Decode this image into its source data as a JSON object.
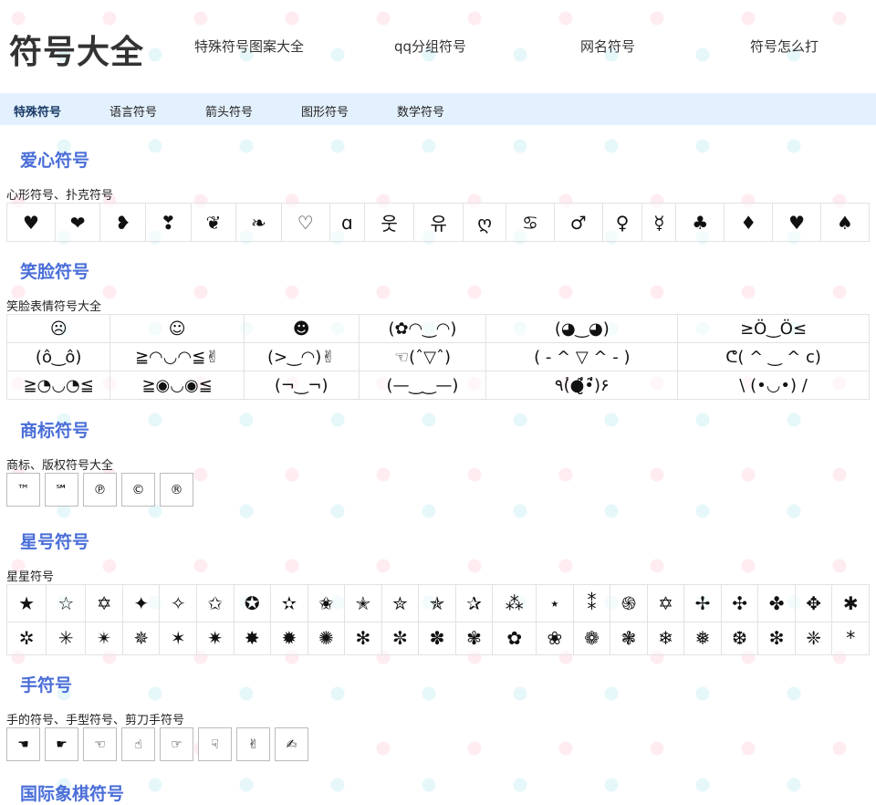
{
  "site": {
    "logo": "符号大全"
  },
  "topnav": [
    "特殊符号图案大全",
    "qq分组符号",
    "网名符号",
    "符号怎么打"
  ],
  "subnav": [
    "特殊符号",
    "语言符号",
    "箭头符号",
    "图形符号",
    "数学符号"
  ],
  "sections": {
    "heart": {
      "title": "爱心符号",
      "desc": "心形符号、扑克符号",
      "symbols": [
        "♥",
        "❤",
        "❥",
        "❣",
        "❦",
        "❧",
        "♡",
        "ɑ",
        "웃",
        "유",
        "ღ",
        "♋",
        "♂",
        "♀",
        "☿",
        "♣",
        "♦",
        "♥",
        "♠"
      ]
    },
    "smile": {
      "title": "笑脸符号",
      "desc": "笑脸表情符号大全",
      "rows": [
        [
          "☹",
          "☺",
          "☻",
          "(✿◠‿◠)",
          "(◕‿◕)",
          "≥Ö‿Ö≤"
        ],
        [
          "(ô‿ô)",
          "≧◠◡◠≦✌",
          "(>‿◠)✌",
          "☜(ˆ▽ˆ)",
          "( - ^ ▽ ^ - )",
          "ᕦ( ^ ‿ ^ c)"
        ],
        [
          "≧◔◡◔≦",
          "≧◉◡◉≦",
          "(¬‿¬)",
          "(—‿‿—)",
          "٩(̾●̮̮̃̾•̃̾)۶",
          "\\ (•◡•) /"
        ]
      ]
    },
    "trademark": {
      "title": "商标符号",
      "desc": "商标、版权符号大全",
      "symbols": [
        "™",
        "℠",
        "℗",
        "©",
        "®"
      ]
    },
    "star": {
      "title": "星号符号",
      "desc": "星星符号",
      "rows": [
        [
          "★",
          "☆",
          "✡",
          "✦",
          "✧",
          "✩",
          "✪",
          "✫",
          "✬",
          "✭",
          "✮",
          "✯",
          "✰",
          "⁂",
          "⋆",
          "⁑",
          "֍",
          "✡",
          "✢",
          "✣",
          "✤",
          "✥",
          "✱"
        ],
        [
          "✲",
          "✳",
          "✴",
          "✵",
          "✶",
          "✷",
          "✸",
          "✹",
          "✺",
          "✻",
          "✼",
          "✽",
          "✾",
          "✿",
          "❀",
          "❁",
          "❃",
          "❄",
          "❅",
          "❆",
          "❇",
          "❈",
          "*"
        ]
      ]
    },
    "hand": {
      "title": "手符号",
      "desc": "手的符号、手型符号、剪刀手符号",
      "symbols": [
        "☚",
        "☛",
        "☜",
        "☝",
        "☞",
        "☟",
        "✌",
        "✍"
      ]
    },
    "chess": {
      "title": "国际象棋符号"
    }
  }
}
